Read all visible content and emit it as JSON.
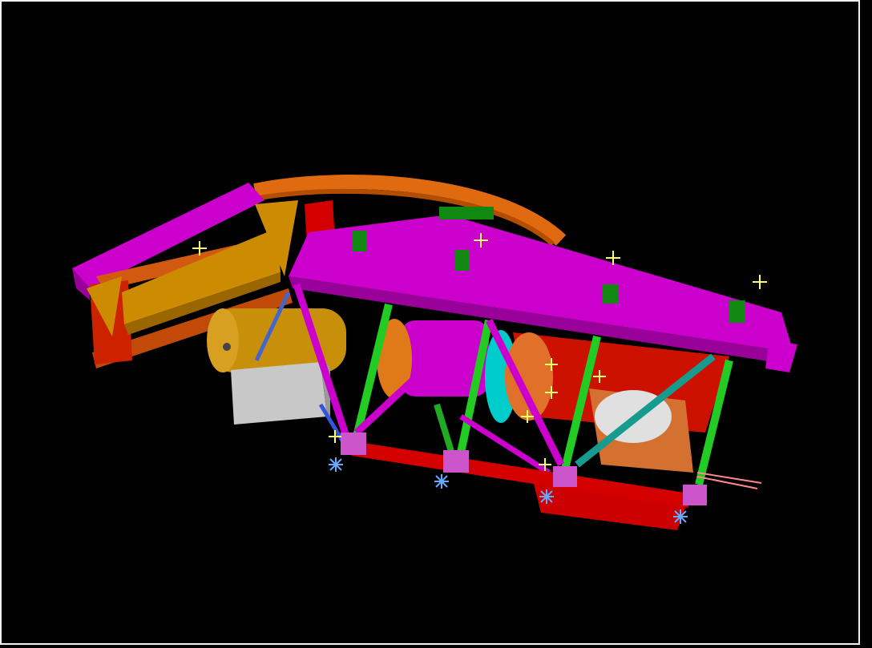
{
  "viewport": {
    "background": "#000000",
    "frame_color": "#f2f2f2"
  },
  "scene": {
    "description_name": "cad-3d-model-view",
    "palette": {
      "magenta": "#cc00cc",
      "magenta_dark": "#990099",
      "orange": "#e06a10",
      "orange_dark": "#b34d00",
      "red": "#d40000",
      "red_dark": "#990000",
      "gold": "#cc8b00",
      "gold_dark": "#996600",
      "green": "#22cc22",
      "green_dark": "#118811",
      "teal": "#159b8f",
      "gray": "#c8c8c8",
      "gray_dark": "#9a9a9a",
      "cyan": "#00cccc",
      "blue": "#3355dd",
      "yellow": "#ffff66",
      "light_blue": "#66aaff"
    }
  }
}
